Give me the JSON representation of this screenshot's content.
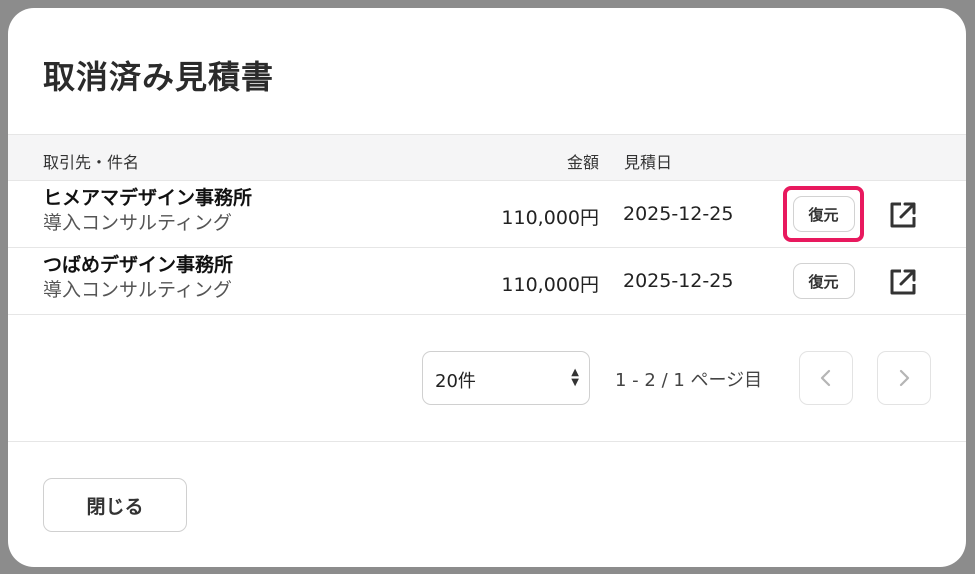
{
  "modal": {
    "title": "取消済み見積書"
  },
  "table": {
    "headers": {
      "name": "取引先・件名",
      "amount": "金額",
      "date": "見積日"
    },
    "rows": [
      {
        "client": "ヒメアマデザイン事務所",
        "project": "導入コンサルティング",
        "amount": "110,000円",
        "date": "2025-12-25",
        "restore_label": "復元",
        "highlighted": true
      },
      {
        "client": "つばめデザイン事務所",
        "project": "導入コンサルティング",
        "amount": "110,000円",
        "date": "2025-12-25",
        "restore_label": "復元",
        "highlighted": false
      }
    ]
  },
  "pagination": {
    "per_page": "20件",
    "page_info": "1 - 2 / 1 ページ目"
  },
  "footer": {
    "close_label": "閉じる"
  },
  "colors": {
    "highlight": "#e8195e",
    "backdrop": "#8c8c8c"
  },
  "icons": {
    "open_link": "external-link-icon",
    "prev": "chevron-left-icon",
    "next": "chevron-right-icon"
  }
}
